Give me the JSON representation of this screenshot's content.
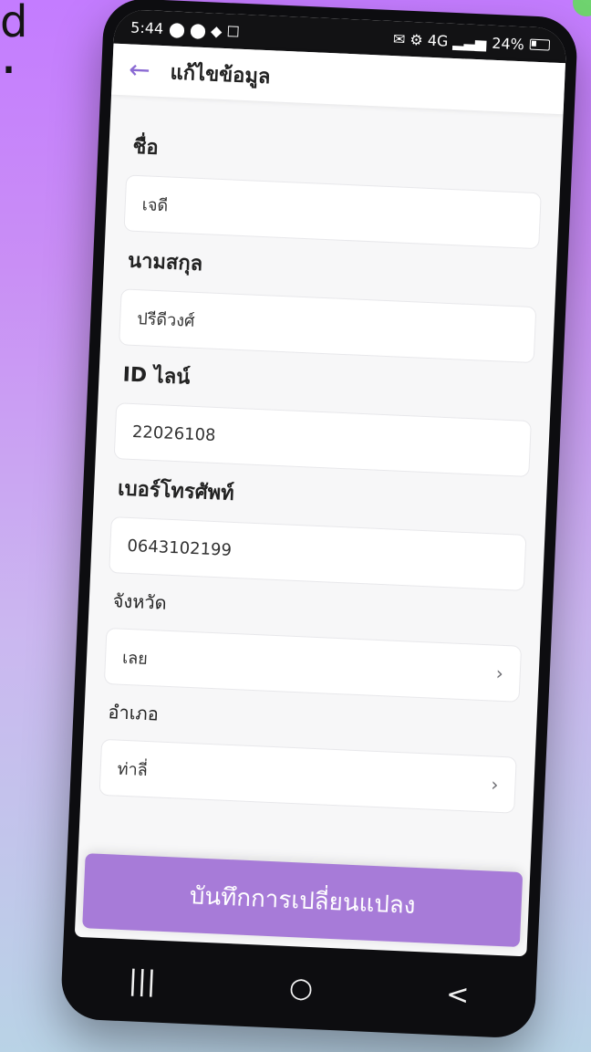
{
  "status_bar": {
    "time": "5:44",
    "battery": "24%"
  },
  "header": {
    "title": "แก้ไขข้อมูล"
  },
  "form": {
    "first_name_label": "ชื่อ",
    "first_name_value": "เจดี",
    "last_name_label": "นามสกุล",
    "last_name_value": "ปรีดีวงศ์",
    "line_id_label": "ID ไลน์",
    "line_id_value": "22026108",
    "phone_label": "เบอร์โทรศัพท์",
    "phone_value": "0643102199",
    "province_label": "จังหวัด",
    "province_value": "เลย",
    "district_label": "อำเภอ",
    "district_value": "ท่าลี่"
  },
  "actions": {
    "save_label": "บันทึกการเปลี่ยนแปลง"
  },
  "navigation": {
    "recent_apps": "|||",
    "home": "○",
    "back": "<"
  },
  "background": {
    "line1": "d",
    "line2": "."
  },
  "colors": {
    "accent": "#a77bd8",
    "background": "#f7f7f8",
    "surface": "#ffffff"
  }
}
